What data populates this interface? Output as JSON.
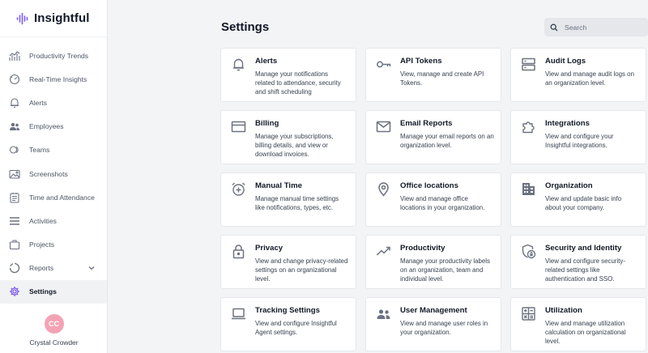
{
  "brand": {
    "name": "Insightful"
  },
  "sidebar": {
    "items": [
      {
        "label": "Productivity Trends",
        "icon": "trend-chart-icon"
      },
      {
        "label": "Real-Time Insights",
        "icon": "gauge-icon"
      },
      {
        "label": "Alerts",
        "icon": "bell-icon"
      },
      {
        "label": "Employees",
        "icon": "people-icon"
      },
      {
        "label": "Teams",
        "icon": "teams-icon"
      },
      {
        "label": "Screenshots",
        "icon": "image-icon"
      },
      {
        "label": "Time and Attendance",
        "icon": "calendar-icon"
      },
      {
        "label": "Activities",
        "icon": "list-icon"
      },
      {
        "label": "Projects",
        "icon": "briefcase-icon"
      },
      {
        "label": "Reports",
        "icon": "pie-chart-icon"
      },
      {
        "label": "Settings",
        "icon": "gear-icon",
        "active": true
      }
    ]
  },
  "user": {
    "initials": "CC",
    "name": "Crystal Crowder"
  },
  "page": {
    "title": "Settings"
  },
  "search": {
    "placeholder": "Search"
  },
  "cards": [
    {
      "title": "Alerts",
      "desc": "Manage your notifications related to attendance, security and shift scheduling",
      "icon": "bell-icon"
    },
    {
      "title": "API Tokens",
      "desc": "View, manage and create API Tokens.",
      "icon": "key-icon"
    },
    {
      "title": "Audit Logs",
      "desc": "View and manage audit logs on an organization level.",
      "icon": "server-icon"
    },
    {
      "title": "Billing",
      "desc": "Manage your subscriptions, billing details, and view or download invoices.",
      "icon": "credit-card-icon"
    },
    {
      "title": "Email Reports",
      "desc": "Manage your email reports on an organization level.",
      "icon": "envelope-icon"
    },
    {
      "title": "Integrations",
      "desc": "View and configure your Insightful integrations.",
      "icon": "puzzle-icon"
    },
    {
      "title": "Manual Time",
      "desc": "Manage manual time settings like notifications, types, etc.",
      "icon": "alarm-add-icon"
    },
    {
      "title": "Office locations",
      "desc": "View and manage office locations in your organization.",
      "icon": "map-pin-icon"
    },
    {
      "title": "Organization",
      "desc": "View and update basic info about your company.",
      "icon": "building-icon"
    },
    {
      "title": "Privacy",
      "desc": "View and change privacy-related settings on an organizational level.",
      "icon": "lock-icon"
    },
    {
      "title": "Productivity",
      "desc": "Manage your productivity labels on an organization, team and individual level.",
      "icon": "trend-line-icon"
    },
    {
      "title": "Security and Identity",
      "desc": "View and configure security-related settings like authentication and SSO.",
      "icon": "shield-lock-icon"
    },
    {
      "title": "Tracking Settings",
      "desc": "View and configure Insightful Agent settings.",
      "icon": "laptop-icon"
    },
    {
      "title": "User Management",
      "desc": "View and manage user roles in your organization.",
      "icon": "user-roles-icon"
    },
    {
      "title": "Utilization",
      "desc": "View and manage utilization calculation on organizational level.",
      "icon": "calculator-icon"
    }
  ],
  "colors": {
    "logo_accent": "#7c5cf0",
    "avatar_bg": "#f4a3b5",
    "icon_gray": "#6b7280"
  }
}
